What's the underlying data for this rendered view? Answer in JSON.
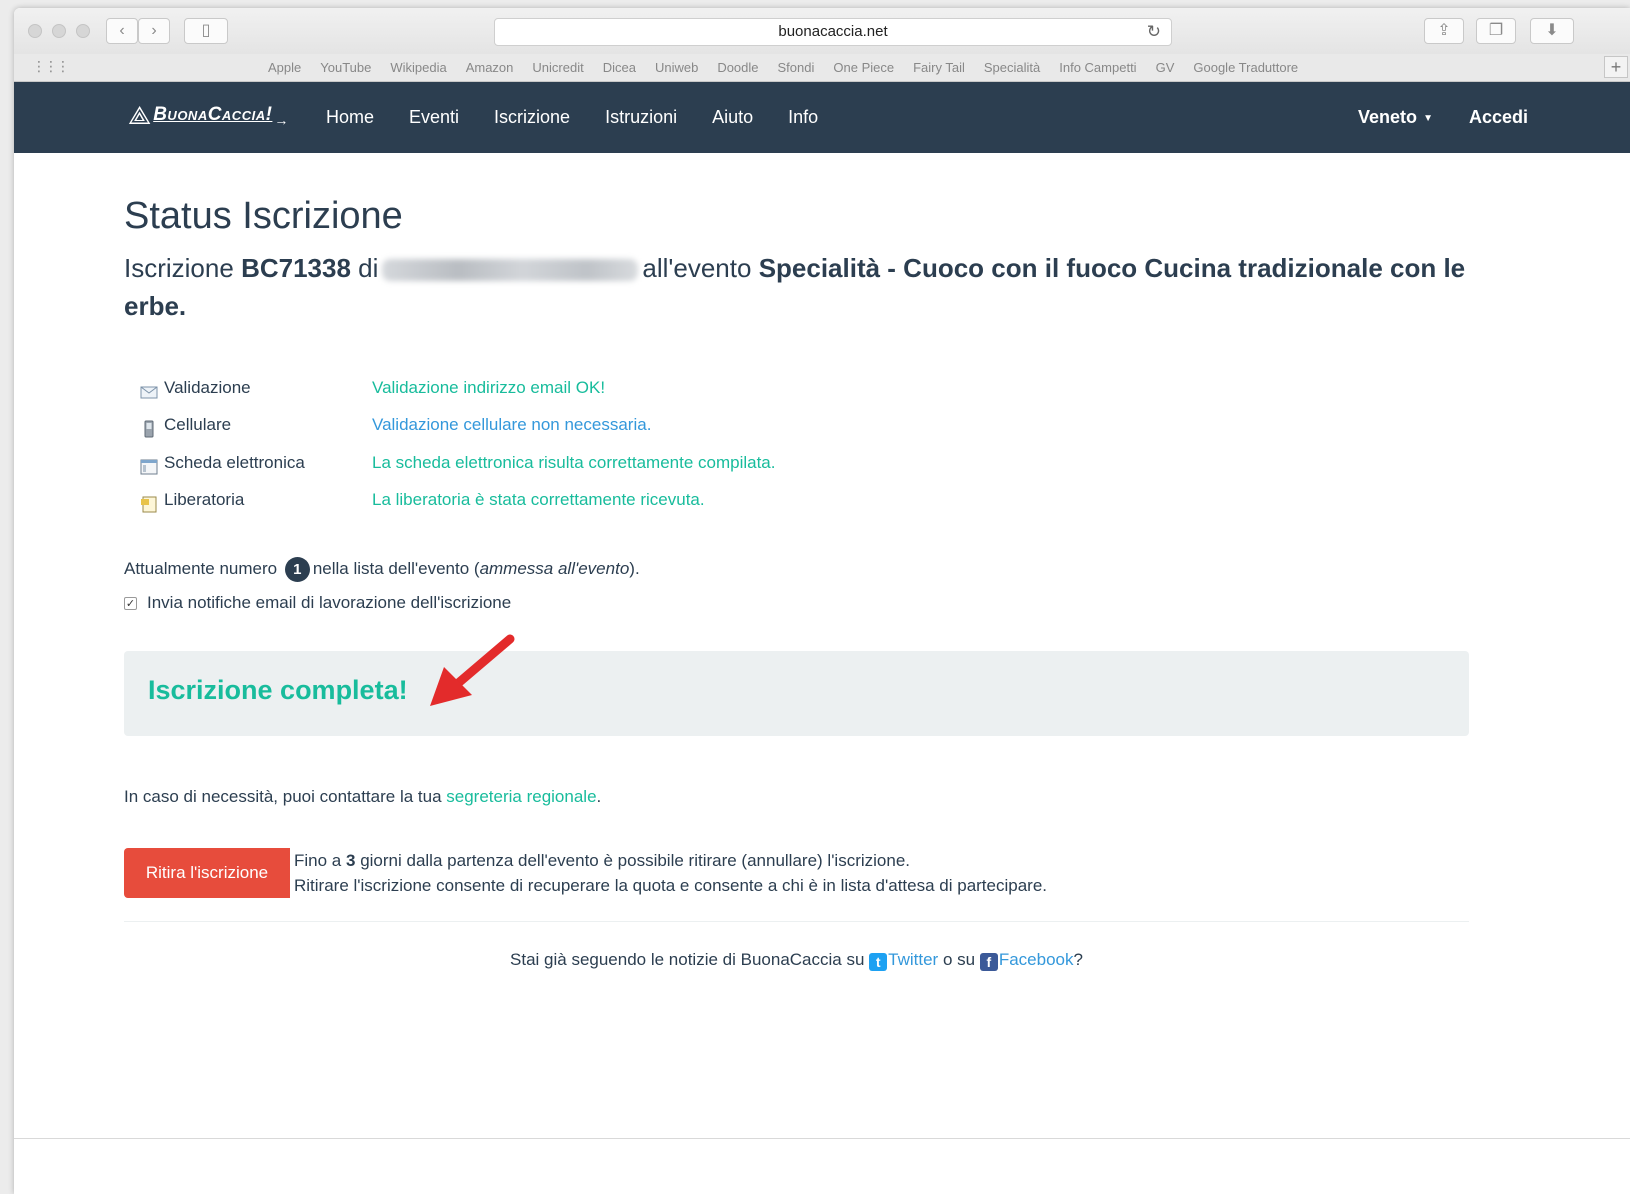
{
  "browser": {
    "url": "buonacaccia.net",
    "bookmarks": [
      "Apple",
      "YouTube",
      "Wikipedia",
      "Amazon",
      "Unicredit",
      "Dicea",
      "Uniweb",
      "Doodle",
      "Sfondi",
      "One Piece",
      "Fairy Tail",
      "Specialità",
      "Info Campetti",
      "GV",
      "Google Traduttore"
    ]
  },
  "navbar": {
    "brand": "BuonaCaccia!",
    "items": [
      "Home",
      "Eventi",
      "Iscrizione",
      "Istruzioni",
      "Aiuto",
      "Info"
    ],
    "region": "Veneto",
    "login": "Accedi"
  },
  "page": {
    "title": "Status Iscrizione",
    "subtitle": {
      "prefix": "Iscrizione",
      "code": "BC71338",
      "of": "di",
      "to_event": "all'evento",
      "event_name": "Specialità - Cuoco con il fuoco Cucina tradizionale con le erbe."
    },
    "status_rows": [
      {
        "label": "Validazione",
        "value": "Validazione indirizzo email OK!",
        "icon": "envelope-icon",
        "color": "#18bc9c"
      },
      {
        "label": "Cellulare",
        "value": "Validazione cellulare non necessaria.",
        "icon": "phone-icon",
        "color": "#3498db"
      },
      {
        "label": "Scheda elettronica",
        "value": "La scheda elettronica risulta correttamente compilata.",
        "icon": "form-icon",
        "color": "#18bc9c"
      },
      {
        "label": "Liberatoria",
        "value": "La liberatoria è stata correttamente ricevuta.",
        "icon": "document-icon",
        "color": "#18bc9c"
      }
    ],
    "position": {
      "prefix": "Attualmente numero",
      "number": "1",
      "middle": "nella lista dell'evento (",
      "status": "ammessa all'evento",
      "suffix": ")."
    },
    "notify_checkbox": {
      "label": "Invia notifiche email di lavorazione dell'iscrizione",
      "checked": true
    },
    "complete_message": "Iscrizione completa!",
    "contact": {
      "prefix": "In caso di necessità, puoi contattare la tua",
      "link": "segreteria regionale",
      "suffix": "."
    },
    "withdraw": {
      "button": "Ritira l'iscrizione",
      "line1_prefix": "Fino a",
      "line1_days": "3",
      "line1_suffix": "giorni dalla partenza dell'evento è possibile ritirare (annullare) l'iscrizione.",
      "line2": "Ritirare l'iscrizione consente di recuperare la quota e consente a chi è in lista d'attesa di partecipare."
    },
    "social": {
      "prefix": "Stai già seguendo le notizie di BuonaCaccia su",
      "twitter": "Twitter",
      "or": "o su",
      "facebook": "Facebook",
      "suffix": "?"
    }
  },
  "colors": {
    "navbar": "#2c3e50",
    "success": "#18bc9c",
    "info": "#3498db",
    "danger": "#e74c3c",
    "annotation": "#e32b2b"
  }
}
